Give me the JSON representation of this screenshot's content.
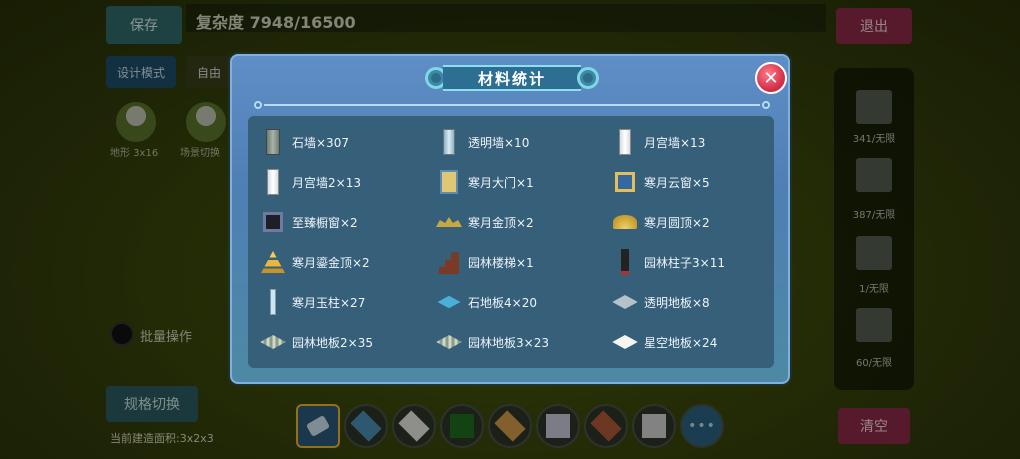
{
  "background": {
    "save_label": "保存",
    "complexity_label": "复杂度",
    "complexity_value": "7948/16500",
    "design_mode_label": "设计模式",
    "free_label": "自由",
    "thumbs": [
      {
        "label": "地形 3x16"
      },
      {
        "label": "场景切换"
      }
    ],
    "exit_label": "退出",
    "right_panel": [
      {
        "label": "341/无限"
      },
      {
        "label": "387/无限"
      },
      {
        "label": "1/无限"
      },
      {
        "label": "60/无限"
      }
    ],
    "batch_label": "批量操作",
    "switch_label": "规格切换",
    "current_text": "当前建造面积:3x2x3",
    "clear_label": "清空",
    "hotbar_more": "•••",
    "hotbar_colors": [
      "#2b5a7a",
      "#4a8fb3",
      "#e5e5e0",
      "#1f6b1f",
      "#d49a4a",
      "#c9c9d8",
      "#b05a3a",
      "#d2d2d2"
    ]
  },
  "modal": {
    "title": "材料统计",
    "close_icon": "close-icon",
    "items": [
      {
        "label": "石墙×307",
        "icon": "stone-wall-icon"
      },
      {
        "label": "透明墙×10",
        "icon": "glass-wall-icon"
      },
      {
        "label": "月宫墙×13",
        "icon": "moon-palace-wall-icon"
      },
      {
        "label": "月宫墙2×13",
        "icon": "moon-palace-wall-2-icon"
      },
      {
        "label": "寒月大门×1",
        "icon": "cold-moon-gate-icon"
      },
      {
        "label": "寒月云窗×5",
        "icon": "cold-moon-cloud-window-icon"
      },
      {
        "label": "至臻橱窗×2",
        "icon": "showcase-window-icon"
      },
      {
        "label": "寒月金顶×2",
        "icon": "golden-roof-icon"
      },
      {
        "label": "寒月圆顶×2",
        "icon": "round-dome-icon"
      },
      {
        "label": "寒月鎏金顶×2",
        "icon": "gilded-roof-icon"
      },
      {
        "label": "园林楼梯×1",
        "icon": "garden-stairs-icon"
      },
      {
        "label": "园林柱子3×11",
        "icon": "garden-pillar-icon"
      },
      {
        "label": "寒月玉柱×27",
        "icon": "jade-pillar-icon"
      },
      {
        "label": "石地板4×20",
        "icon": "stone-floor-icon"
      },
      {
        "label": "透明地板×8",
        "icon": "glass-floor-icon"
      },
      {
        "label": "园林地板2×35",
        "icon": "garden-floor-2-icon"
      },
      {
        "label": "园林地板3×23",
        "icon": "garden-floor-3-icon"
      },
      {
        "label": "星空地板×24",
        "icon": "starry-floor-icon"
      }
    ]
  }
}
